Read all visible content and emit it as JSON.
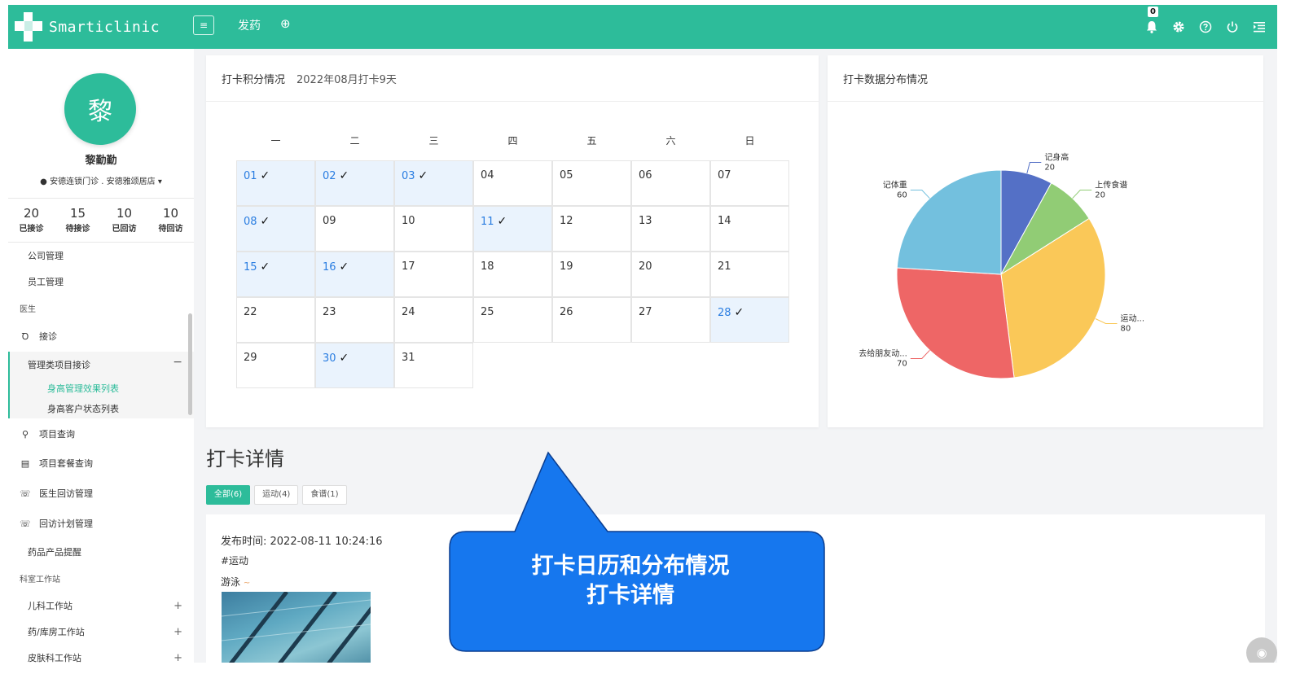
{
  "app": {
    "brand": "Smarticlinic",
    "menu_toggle": "≡",
    "nav_title": "发药",
    "nav_add": "⊕",
    "notif_count": "0",
    "icons": [
      "bell-icon",
      "gear-icon",
      "help-icon",
      "power-icon",
      "indent-icon"
    ],
    "accent": "#2dbc9a"
  },
  "user": {
    "avatar_char": "黎",
    "name": "黎勤勤",
    "location": "安德连锁门诊 . 安德雅颂居店"
  },
  "stats": [
    {
      "num": "20",
      "label": "已接诊"
    },
    {
      "num": "15",
      "label": "待接诊"
    },
    {
      "num": "10",
      "label": "已回访"
    },
    {
      "num": "10",
      "label": "待回访"
    }
  ],
  "menu": {
    "company": "公司管理",
    "staff": "员工管理",
    "doctor_section": "医生",
    "consult": "接诊",
    "mgmt_consult": "管理类项目接诊",
    "mgmt_collapse": "−",
    "height_effect": "身高管理效果列表",
    "height_status": "身高客户状态列表",
    "project_query": "项目查询",
    "package_query": "项目套餐查询",
    "doctor_followup": "医生回访管理",
    "followup_plan": "回访计划管理",
    "drug_reminder": "药品产品提醒",
    "dept_section": "科室工作站",
    "pediatrics": "儿科工作站",
    "pharmacy": "药/库房工作站",
    "dermatology": "皮肤科工作站",
    "plus": "+"
  },
  "calendar": {
    "title": "打卡积分情况",
    "subtitle": "2022年08月打卡9天",
    "weekdays": [
      "一",
      "二",
      "三",
      "四",
      "五",
      "六",
      "日"
    ],
    "days": [
      {
        "d": "01",
        "c": true
      },
      {
        "d": "02",
        "c": true
      },
      {
        "d": "03",
        "c": true
      },
      {
        "d": "04",
        "c": false
      },
      {
        "d": "05",
        "c": false
      },
      {
        "d": "06",
        "c": false
      },
      {
        "d": "07",
        "c": false
      },
      {
        "d": "08",
        "c": true
      },
      {
        "d": "09",
        "c": false
      },
      {
        "d": "10",
        "c": false
      },
      {
        "d": "11",
        "c": true
      },
      {
        "d": "12",
        "c": false
      },
      {
        "d": "13",
        "c": false
      },
      {
        "d": "14",
        "c": false
      },
      {
        "d": "15",
        "c": true
      },
      {
        "d": "16",
        "c": true
      },
      {
        "d": "17",
        "c": false
      },
      {
        "d": "18",
        "c": false
      },
      {
        "d": "19",
        "c": false
      },
      {
        "d": "20",
        "c": false
      },
      {
        "d": "21",
        "c": false
      },
      {
        "d": "22",
        "c": false
      },
      {
        "d": "23",
        "c": false
      },
      {
        "d": "24",
        "c": false
      },
      {
        "d": "25",
        "c": false
      },
      {
        "d": "26",
        "c": false
      },
      {
        "d": "27",
        "c": false
      },
      {
        "d": "28",
        "c": true
      },
      {
        "d": "29",
        "c": false
      },
      {
        "d": "30",
        "c": true
      },
      {
        "d": "31",
        "c": false
      }
    ],
    "tick": "✓",
    "checked_bg": "#eaf3fd",
    "checked_text": "#2a7de1"
  },
  "pie": {
    "title": "打卡数据分布情况"
  },
  "chart_data": {
    "type": "pie",
    "title": "",
    "slices": [
      {
        "name": "记身高",
        "value": 20,
        "color": "#5470c6"
      },
      {
        "name": "上传食谱",
        "value": 20,
        "color": "#91cc75"
      },
      {
        "name": "运动...",
        "value": 80,
        "color": "#fac858"
      },
      {
        "name": "去给朋友动...",
        "value": 70,
        "color": "#ee6666"
      },
      {
        "name": "记体重",
        "value": 60,
        "color": "#73c0de"
      }
    ]
  },
  "detail": {
    "title": "打卡详情",
    "tabs": [
      "全部(6)",
      "运动(4)",
      "食谱(1)"
    ],
    "post_time": "发布时间: 2022-08-11 10:24:16",
    "post_tag": "#运动",
    "post_text": "游泳"
  },
  "callout": {
    "line1": "打卡日历和分布情况",
    "line2": "打卡详情",
    "fill": "#1677ee"
  }
}
